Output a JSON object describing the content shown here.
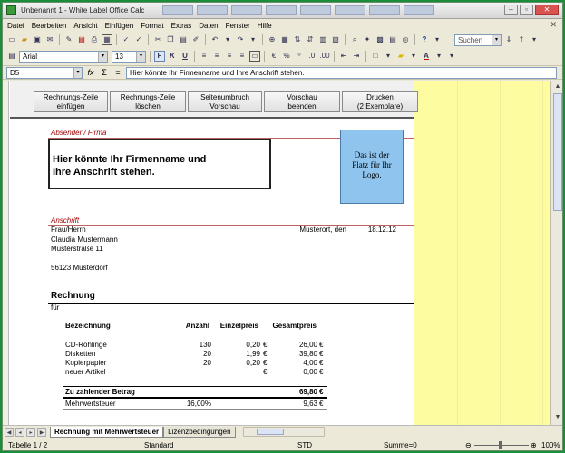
{
  "window": {
    "title": "Unbenannt 1 - White Label Office Calc",
    "controls": [
      "–",
      "▫",
      "✕"
    ]
  },
  "menu": {
    "items": [
      "Datei",
      "Bearbeiten",
      "Ansicht",
      "Einfügen",
      "Format",
      "Extras",
      "Daten",
      "Fenster",
      "Hilfe"
    ],
    "close": "✕"
  },
  "toolbar": {
    "search_placeholder": "Suchen"
  },
  "formatbar": {
    "font": "Arial",
    "size": "13",
    "bold": "F",
    "italic": "K",
    "underline": "U"
  },
  "formula": {
    "cell_ref": "D5",
    "fx": "fx",
    "sum": "Σ",
    "equals": "=",
    "content": "Hier könnte Ihr Firmenname und  Ihre Anschrift stehen."
  },
  "macro_buttons": [
    {
      "line1": "Rechnungs-Zeile",
      "line2": "einfügen"
    },
    {
      "line1": "Rechnungs-Zeile",
      "line2": "löschen"
    },
    {
      "line1": "Seitenumbruch",
      "line2": "Vorschau"
    },
    {
      "line1": "Vorschau",
      "line2": "beenden"
    },
    {
      "line1": "Drucken",
      "line2": "(2 Exemplare)"
    }
  ],
  "document": {
    "sender_label": "Absender / Firma",
    "company_placeholder_1": "Hier könnte Ihr Firmenname und",
    "company_placeholder_2": "Ihre Anschrift stehen.",
    "logo_1": "Das ist der",
    "logo_2": "Platz für Ihr",
    "logo_3": "Logo.",
    "address_label": "Anschrift",
    "salutation": "Frau/Herrn",
    "name": "Claudia Mustermann",
    "street": "Musterstraße 11",
    "city": "56123 Musterdorf",
    "place_date_label": "Musterort, den",
    "date": "18.12.12",
    "invoice_title": "Rechnung",
    "for_label": "für"
  },
  "invoice_table": {
    "headers": {
      "desc": "Bezeichnung",
      "qty": "Anzahl",
      "unit": "Einzelpreis",
      "total": "Gesamtpreis"
    },
    "rows": [
      {
        "desc": "CD-Rohlinge",
        "qty": "130",
        "unit": "0,20",
        "unit_cur": "€",
        "total": "26,00",
        "total_cur": "€"
      },
      {
        "desc": "Disketten",
        "qty": "20",
        "unit": "1,99",
        "unit_cur": "€",
        "total": "39,80",
        "total_cur": "€"
      },
      {
        "desc": "Kopierpapier",
        "qty": "20",
        "unit": "0,20",
        "unit_cur": "€",
        "total": "4,00",
        "total_cur": "€"
      },
      {
        "desc": "neuer Artikel",
        "qty": "",
        "unit": "",
        "unit_cur": "€",
        "total": "0,00",
        "total_cur": "€"
      }
    ],
    "sum_label": "Zu zahlender Betrag",
    "sum_value": "69,80",
    "sum_cur": "€",
    "vat_label": "Mehrwertsteuer",
    "vat_rate": "16,00%",
    "vat_value": "9,63",
    "vat_cur": "€"
  },
  "sheet_tabs": [
    "Rechnung mit Mehrwertsteuer",
    "Lizenzbedingungen"
  ],
  "status": {
    "sheet": "Tabelle 1 / 2",
    "style": "Standard",
    "mode": "STD",
    "sum": "Summe=0",
    "zoom": "100%",
    "zoom_minus": "⊖",
    "zoom_plus": "⊕"
  },
  "colors": {
    "yellow_area": "#fdfca0",
    "logo_box": "#8ec4ee",
    "red_label": "#a40000",
    "frame_green": "#1a8c3a"
  }
}
